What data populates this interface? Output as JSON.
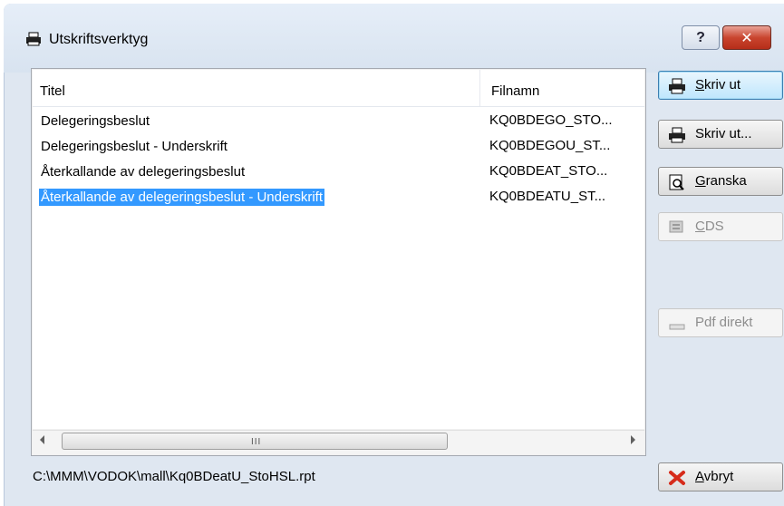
{
  "window": {
    "title": "Utskriftsverktyg",
    "help_label": "?",
    "close_label": "✕"
  },
  "list": {
    "columns": {
      "title": "Titel",
      "filename": "Filnamn"
    },
    "rows": [
      {
        "title": "Delegeringsbeslut",
        "filename": "KQ0BDEGO_STO..."
      },
      {
        "title": "Delegeringsbeslut - Underskrift",
        "filename": "KQ0BDEGOU_ST..."
      },
      {
        "title": "Återkallande av delegeringsbeslut",
        "filename": "KQ0BDEAT_STO..."
      },
      {
        "title": "Återkallande av delegeringsbeslut - Underskrift",
        "filename": "KQ0BDEATU_ST..."
      }
    ],
    "selected_row": 3,
    "scrollbar_grip": "III"
  },
  "status_path": "C:\\MMM\\VODOK\\mall\\Kq0BDeatU_StoHSL.rpt",
  "buttons": {
    "print": {
      "first": "S",
      "rest": "kriv ut"
    },
    "print_dialog": {
      "label": "Skriv ut..."
    },
    "preview": {
      "first": "G",
      "rest": "ranska"
    },
    "cds": {
      "first": "C",
      "rest": "DS"
    },
    "pdf": {
      "label": "Pdf direkt"
    },
    "cancel": {
      "first": "A",
      "rest": "vbryt"
    }
  },
  "colors": {
    "selection": "#3399ff",
    "window_bg": "#dfe7f1",
    "close_red": "#c9452f"
  },
  "icons": [
    "printer-icon",
    "magnifier-document-icon",
    "cds-icon",
    "pdf-icon",
    "red-x-icon"
  ]
}
